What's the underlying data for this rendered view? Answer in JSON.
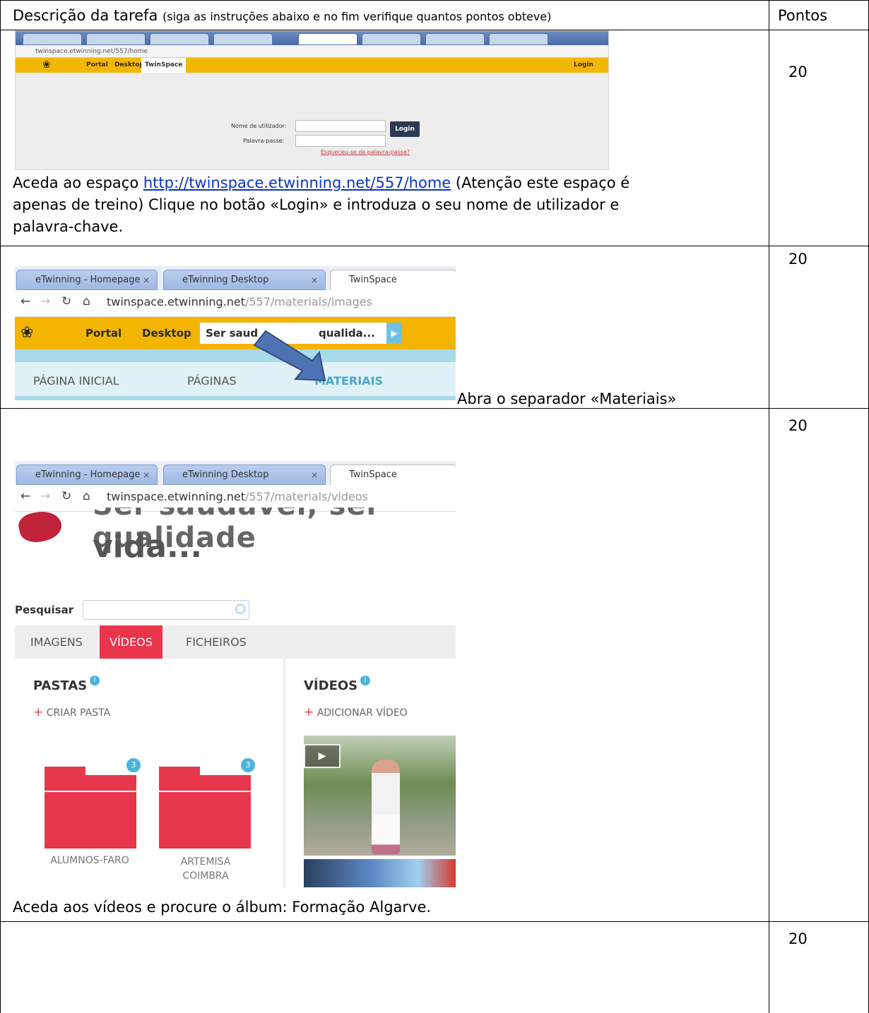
{
  "table": {
    "header": {
      "description_main": "Descrição da tarefa",
      "description_note": "(siga as instruções abaixo e no fim verifique quantos pontos obteve)",
      "points": "Pontos"
    },
    "rows": [
      {
        "points": "20",
        "text_before_link": "Aceda ao espaço ",
        "link": "http://twinspace.etwinning.net/557/home",
        "text_after_link": " (Atenção este espaço é",
        "text_line2": "apenas de treino) Clique no botão «Login» e introduza o seu nome de utilizador e",
        "text_line3": "palavra-chave."
      },
      {
        "points": "20",
        "text": "Abra o separador «Materiais»"
      },
      {
        "points": "20",
        "text": "Aceda aos vídeos e procure o álbum: Formação Algarve."
      },
      {
        "points": "20"
      }
    ]
  },
  "screenshot_login": {
    "url": "twinspace.etwinning.net/557/home",
    "nav": [
      "Portal",
      "Desktop",
      "TwinSpace"
    ],
    "login_link": "Login",
    "username_label": "Nome de utilizador:",
    "password_label": "Palavra-passe:",
    "login_button": "Login",
    "forgot_link": "Esqueceu-se da palavra-passe?"
  },
  "screenshot_materials": {
    "tabs": [
      "eTwinning - Homepage",
      "eTwinning Desktop",
      "TwinSpace"
    ],
    "url_host": "twinspace.etwinning.net",
    "url_path": "/557/materials/images",
    "nav": [
      "Portal",
      "Desktop"
    ],
    "space_tab": "Ser saud",
    "space_tab_tail": "qualida...",
    "menu": [
      "PÁGINA INICIAL",
      "PÁGINAS",
      "MATERIAIS"
    ]
  },
  "screenshot_videos": {
    "tabs": [
      "eTwinning - Homepage",
      "eTwinning Desktop",
      "TwinSpace"
    ],
    "url_host": "twinspace.etwinning.net",
    "url_path": "/557/materials/videos",
    "title_prev": "Ser saudável, ser qualidade",
    "title": "vida...",
    "search_label": "Pesquisar",
    "tabs_media": [
      "IMAGENS",
      "VÍDEOS",
      "FICHEIROS"
    ],
    "folders_title": "PASTAS",
    "create_folder": "CRIAR PASTA",
    "videos_title": "VÍDEOS",
    "add_video": "ADICIONAR VÍDEO",
    "folders": [
      {
        "name_line1": "ALUMNOS-FARO",
        "name_line2": "",
        "count": "3"
      },
      {
        "name_line1": "ARTEMISA",
        "name_line2": "COIMBRA",
        "count": "3"
      }
    ]
  }
}
